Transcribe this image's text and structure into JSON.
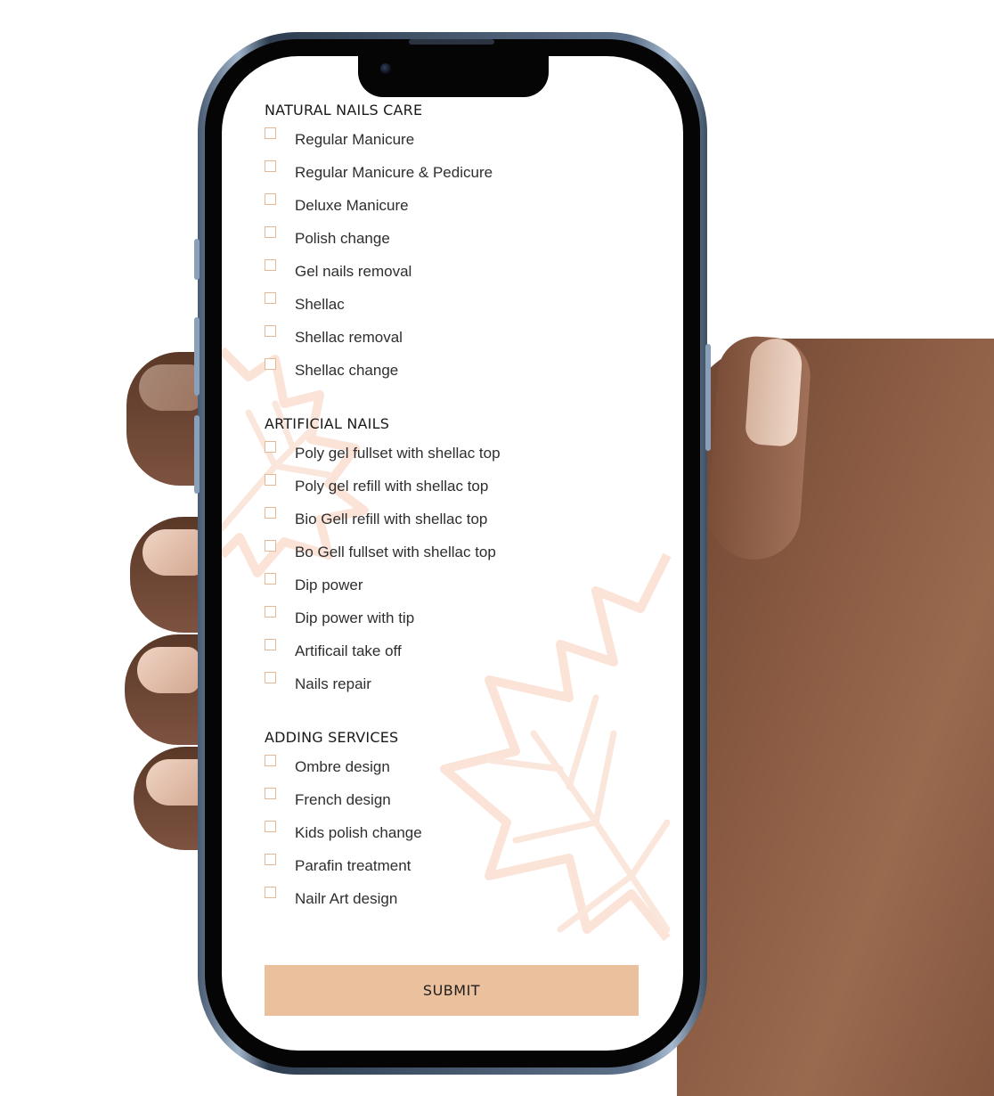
{
  "sections": [
    {
      "title": "NATURAL NAILS CARE",
      "items": [
        "Regular Manicure",
        "Regular Manicure & Pedicure",
        "Deluxe Manicure",
        "Polish change",
        "Gel nails removal",
        "Shellac",
        "Shellac removal",
        "Shellac change"
      ]
    },
    {
      "title": "ARTIFICIAL NAILS",
      "items": [
        "Poly gel fullset with shellac top",
        "Poly gel refill with shellac top",
        "Bio Gell refill with shellac top",
        "Bo Gell fullset with shellac top",
        "Dip power",
        "Dip power with tip",
        "Artificail take off",
        "Nails repair"
      ]
    },
    {
      "title": "ADDING SERVICES",
      "items": [
        "Ombre design",
        "French design",
        "Kids polish change",
        "Parafin treatment",
        "Nailr Art design"
      ]
    }
  ],
  "submit_label": "SUBMIT",
  "colors": {
    "accent": "#ebc09d",
    "checkbox_border": "#e6b894",
    "leaf_watermark": "#fbe4da"
  }
}
